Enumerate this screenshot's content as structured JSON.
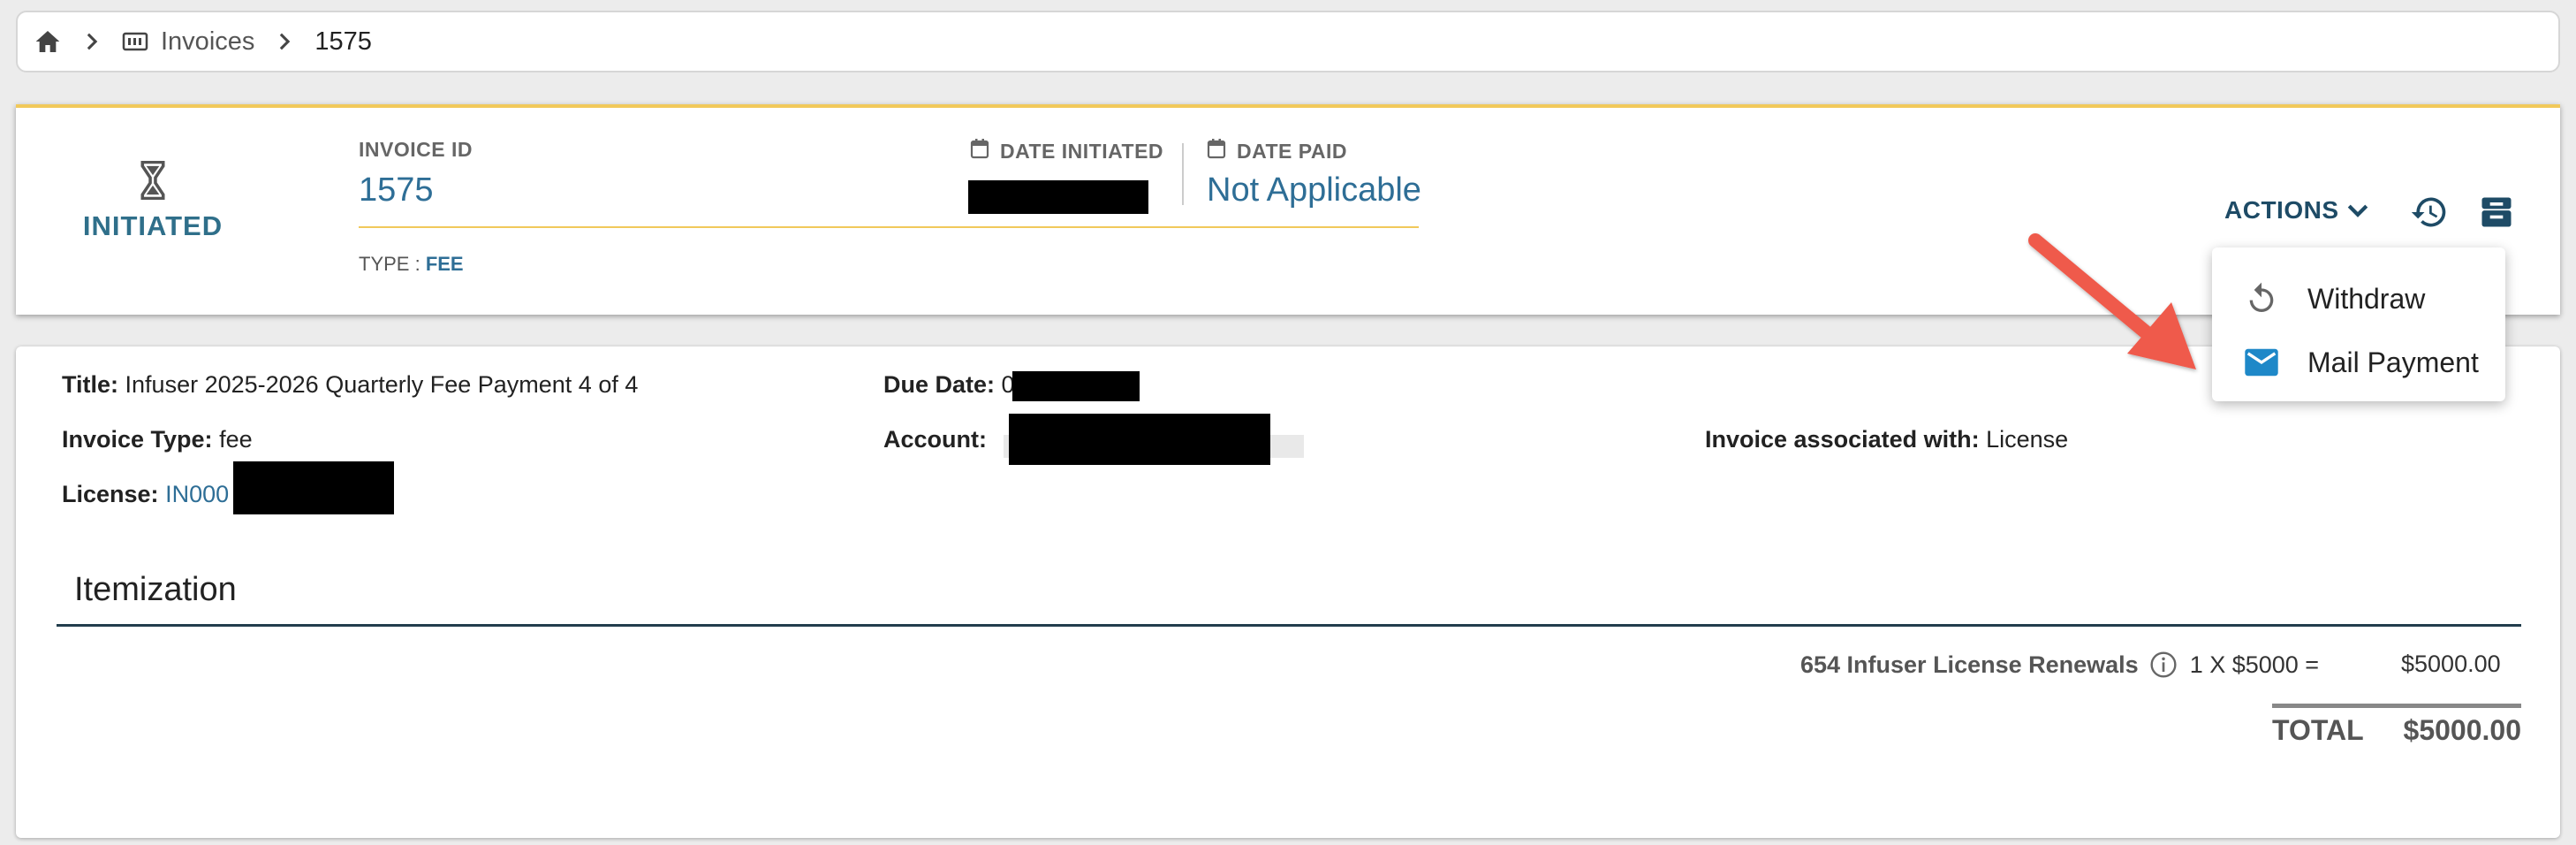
{
  "breadcrumb": {
    "home_icon": "home-icon",
    "invoices_label": "Invoices",
    "current": "1575"
  },
  "header": {
    "status": "INITIATED",
    "invoice_id_label": "INVOICE ID",
    "invoice_id": "1575",
    "type_label": "TYPE :",
    "type_value": "FEE",
    "date_initiated_label": "DATE INITIATED",
    "date_paid_label": "DATE PAID",
    "date_paid_value": "Not Applicable",
    "actions_label": "ACTIONS"
  },
  "menu": {
    "items": [
      {
        "label": "Withdraw",
        "icon": "undo-icon"
      },
      {
        "label": "Mail Payment",
        "icon": "mail-icon"
      }
    ]
  },
  "details": {
    "title_label": "Title:",
    "title_value": "Infuser 2025-2026 Quarterly Fee Payment 4 of 4",
    "due_date_label": "Due Date:",
    "due_date_value": "0",
    "invoice_type_label": "Invoice Type:",
    "invoice_type_value": "fee",
    "account_label": "Account:",
    "associated_label": "Invoice associated with:",
    "associated_value": "License",
    "license_label": "License:",
    "license_value": "IN000"
  },
  "itemization": {
    "title": "Itemization",
    "items": [
      {
        "description": "654 Infuser License Renewals",
        "quantity_expr": "1 X $5000 =",
        "amount": "$5000.00"
      }
    ],
    "total_label": "TOTAL",
    "total_value": "$5000.00"
  },
  "colors": {
    "accent_blue": "#2e6e96",
    "status_yellow": "#f1c95a",
    "arrow_red": "#ef5a4c",
    "mail_icon_blue": "#1e88c8"
  }
}
